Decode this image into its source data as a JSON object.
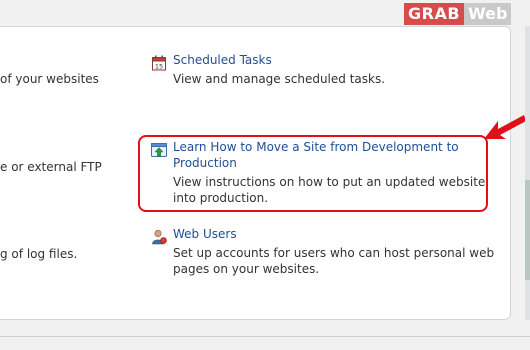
{
  "watermark": {
    "part1": "GRAB",
    "part2": "Web"
  },
  "left_fragments": [
    "of your websites",
    "e or external FTP",
    "g of log files."
  ],
  "items": {
    "scheduled_tasks": {
      "title": "Scheduled Tasks",
      "desc": "View and manage scheduled tasks."
    },
    "move_site": {
      "title_line1": "Learn How to Move a Site from Development to",
      "title_line2": "Production",
      "desc_line1": "View instructions on how to put an updated website",
      "desc_line2": "into production."
    },
    "web_users": {
      "title": "Web Users",
      "desc_line1": "Set up accounts for users who can host personal web",
      "desc_line2": "pages on your websites."
    }
  },
  "colors": {
    "link": "#1f4f93",
    "highlight": "#e0101a",
    "panel_border": "#cfd6de"
  }
}
